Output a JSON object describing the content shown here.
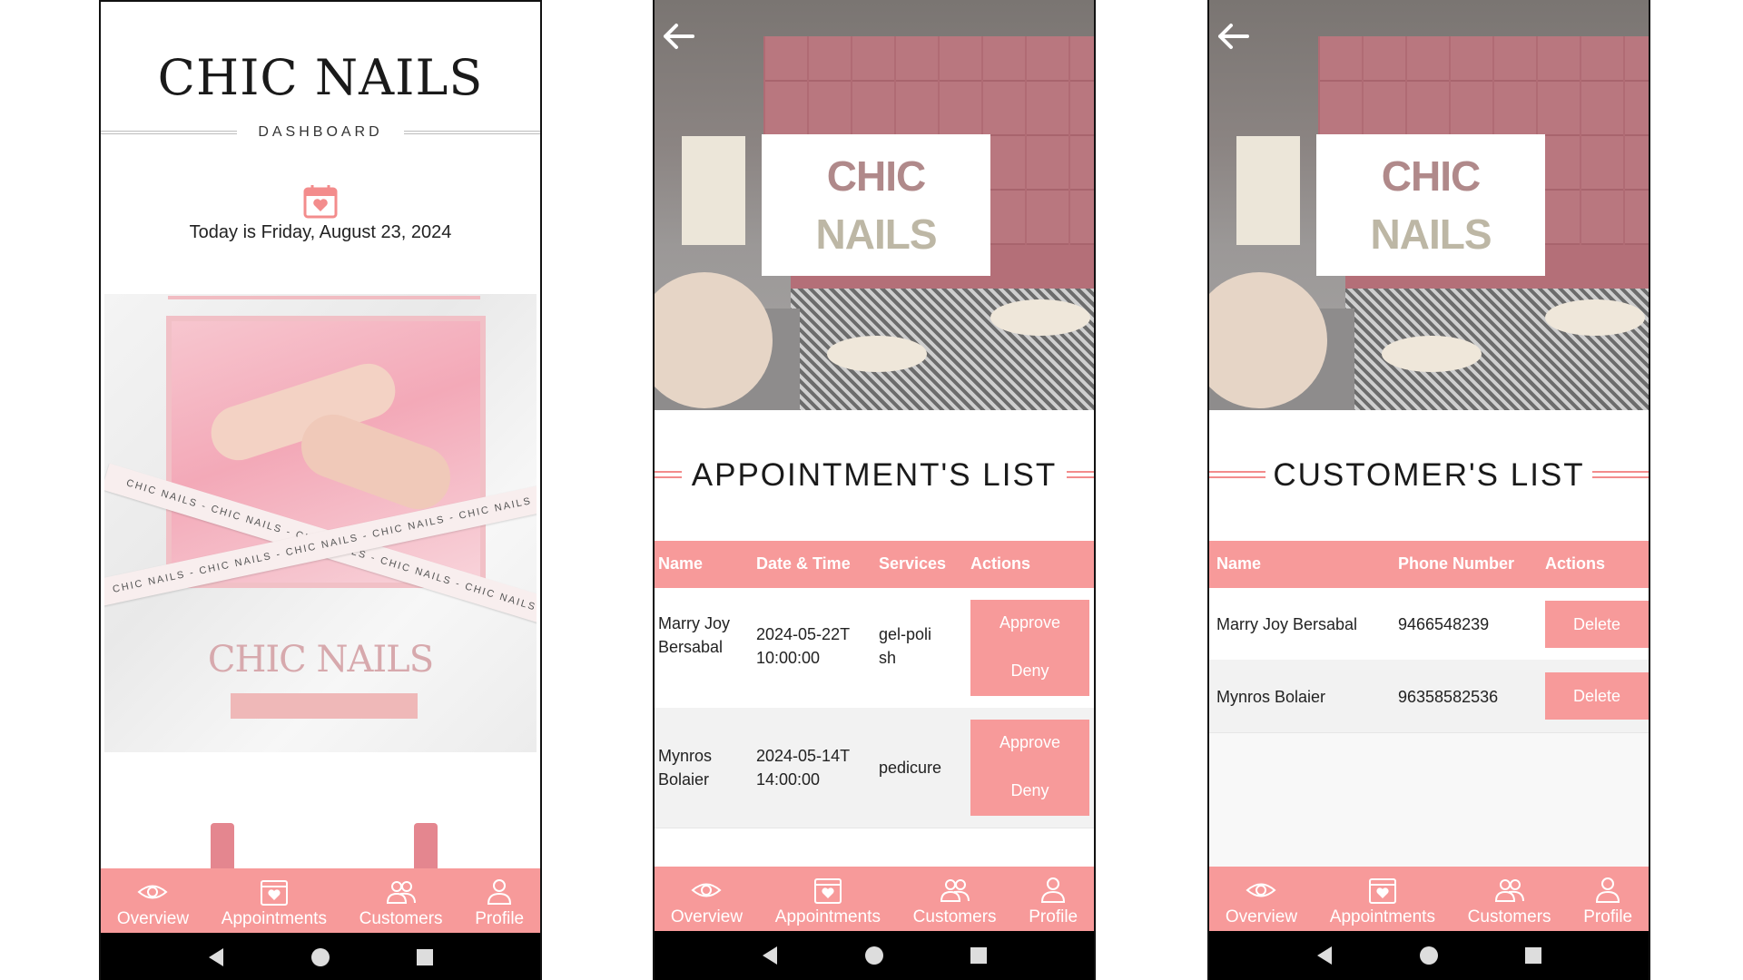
{
  "colors": {
    "accent": "#f79a9a",
    "rule": "#f38c8c",
    "dark": "#1a1a1a"
  },
  "nav": {
    "items": [
      {
        "label": "Overview",
        "icon": "eye-icon"
      },
      {
        "label": "Appointments",
        "icon": "calendar-heart-icon"
      },
      {
        "label": "Customers",
        "icon": "users-icon"
      },
      {
        "label": "Profile",
        "icon": "user-icon"
      }
    ]
  },
  "dashboard": {
    "title": "CHIC NAILS",
    "subtitle": "DASHBOARD",
    "today": "Today is Friday, August 23, 2024",
    "promo": {
      "brand": "CHIC NAILS",
      "tape_text": "CHIC NAILS - CHIC NAILS - CHIC NAILS - CHIC NAILS - CHIC NAILS"
    }
  },
  "hero_logo": {
    "line1": "CHIC",
    "line2": "NAILS"
  },
  "appointments": {
    "title": "APPOINTMENT'S LIST",
    "columns": [
      "Name",
      "Date & Time",
      "Services",
      "Actions"
    ],
    "rows": [
      {
        "name": "Marry Joy Bersabal",
        "datetime": "2024-05-22T10:00:00",
        "service": "gel-polish",
        "approve": "Approve",
        "deny": "Deny"
      },
      {
        "name": "Mynros Bolaier",
        "datetime": "2024-05-14T14:00:00",
        "service": "pedicure",
        "approve": "Approve",
        "deny": "Deny"
      }
    ]
  },
  "customers": {
    "title": "CUSTOMER'S LIST",
    "columns": [
      "Name",
      "Phone Number",
      "Actions"
    ],
    "rows": [
      {
        "name": "Marry Joy Bersabal",
        "phone": "9466548239",
        "action": "Delete"
      },
      {
        "name": "Mynros Bolaier",
        "phone": "96358582536",
        "action": "Delete"
      }
    ]
  }
}
